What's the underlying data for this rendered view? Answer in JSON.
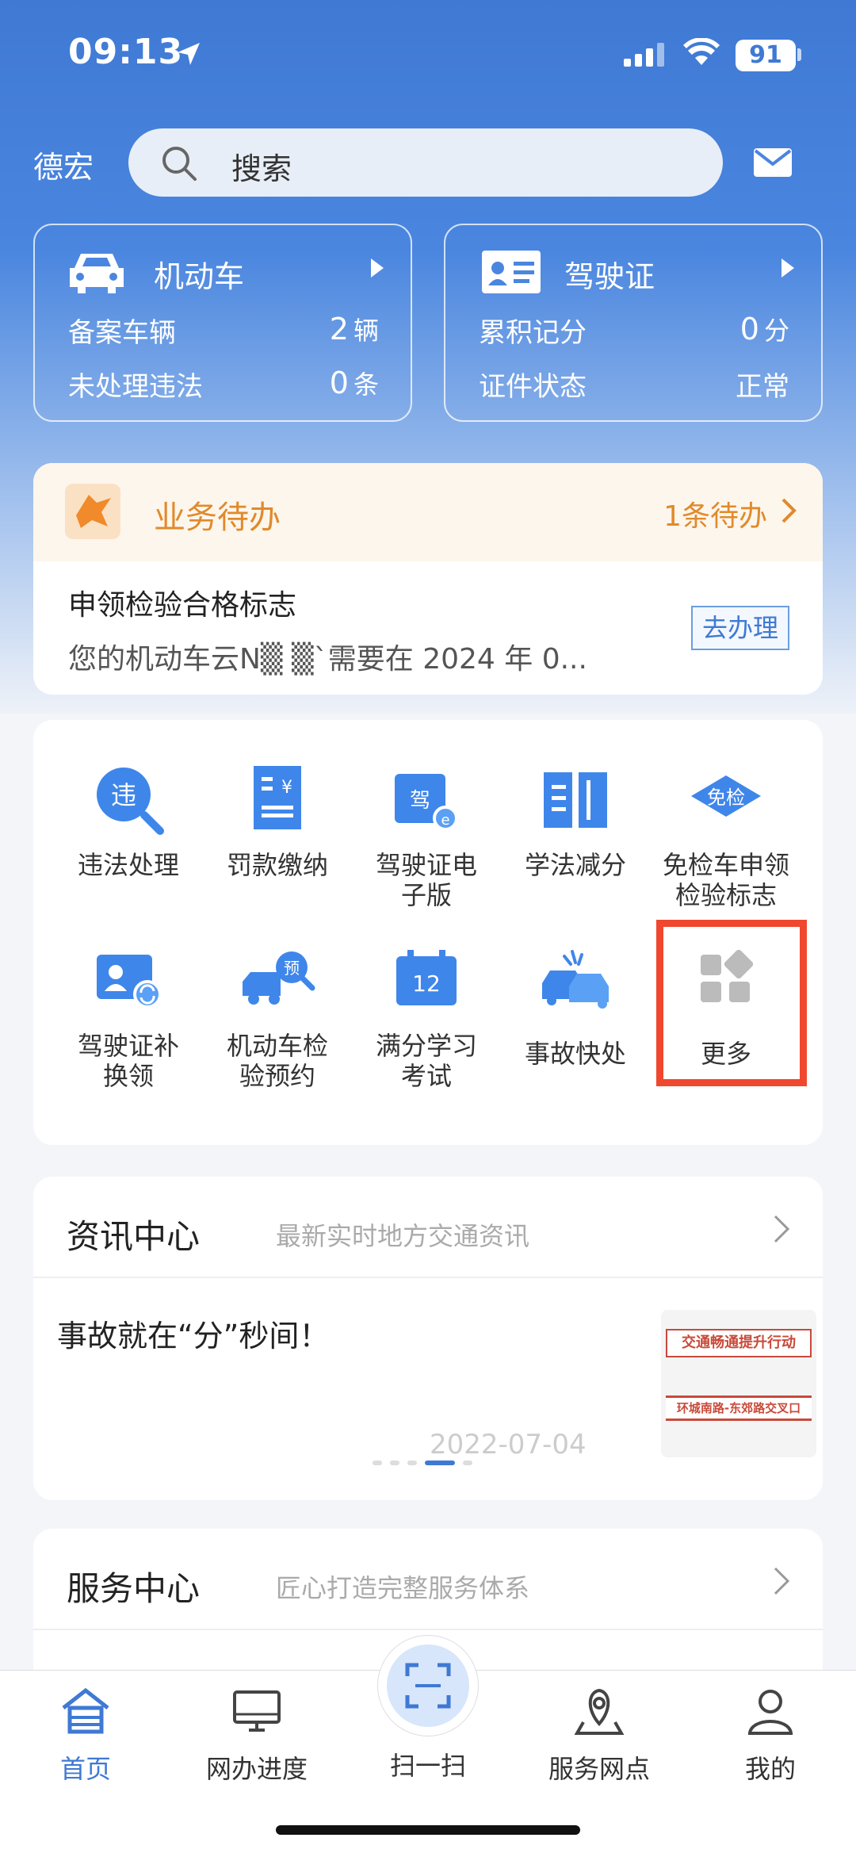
{
  "status_bar": {
    "time": "09:13",
    "battery": "91"
  },
  "header": {
    "city": "德宏",
    "search_placeholder": "搜索"
  },
  "vehicle_card": {
    "title": "机动车",
    "rows": [
      {
        "label": "备案车辆",
        "value": "2",
        "unit": "辆"
      },
      {
        "label": "未处理违法",
        "value": "0",
        "unit": "条"
      }
    ]
  },
  "license_card": {
    "title": "驾驶证",
    "rows": [
      {
        "label": "累积记分",
        "value": "0",
        "unit": "分"
      },
      {
        "label": "证件状态",
        "value": "正常",
        "unit": ""
      }
    ]
  },
  "todo": {
    "title": "业务待办",
    "count": "1条待办",
    "item_title": "申领检验合格标志",
    "item_desc": "您的机动车云N▒ ▒`需要在 2024 年 0...",
    "action": "去办理"
  },
  "services": [
    {
      "label": "违法处理",
      "icon": "violation-icon"
    },
    {
      "label": "罚款缴纳",
      "icon": "fine-payment-icon"
    },
    {
      "label": "驾驶证电子版",
      "label_lines": [
        "驾驶证电",
        "子版"
      ],
      "icon": "e-license-icon"
    },
    {
      "label": "学法减分",
      "icon": "study-book-icon"
    },
    {
      "label": "免检车申领检验标志",
      "label_lines": [
        "免检车申领",
        "检验标志"
      ],
      "icon": "exempt-inspection-icon"
    },
    {
      "label": "驾驶证补换领",
      "label_lines": [
        "驾驶证补",
        "换领"
      ],
      "icon": "license-renew-icon"
    },
    {
      "label": "机动车检验预约",
      "label_lines": [
        "机动车检",
        "验预约"
      ],
      "icon": "inspection-booking-icon"
    },
    {
      "label": "满分学习考试",
      "label_lines": [
        "满分学习",
        "考试"
      ],
      "icon": "calendar-12-icon"
    },
    {
      "label": "事故快处",
      "icon": "accident-icon"
    },
    {
      "label": "更多",
      "icon": "more-grid-icon"
    }
  ],
  "news": {
    "title": "资讯中心",
    "subtitle": "最新实时地方交通资讯",
    "headline": "事故就在“分”秒间！",
    "date": "2022-07-04",
    "thumb_line1": "交通畅通提升行动",
    "thumb_line2": "环城南路-东郊路交叉口"
  },
  "service_center": {
    "title": "服务中心",
    "subtitle": "匠心打造完整服务体系"
  },
  "tabbar": [
    {
      "label": "首页",
      "icon": "home-icon",
      "active": true
    },
    {
      "label": "网办进度",
      "icon": "monitor-icon"
    },
    {
      "label": "扫一扫",
      "icon": "scan-icon"
    },
    {
      "label": "服务网点",
      "icon": "map-pin-icon"
    },
    {
      "label": "我的",
      "icon": "user-icon"
    }
  ],
  "colors": {
    "primary": "#3f79d4",
    "accent_orange": "#e08a2c",
    "highlight": "#f0472f"
  }
}
